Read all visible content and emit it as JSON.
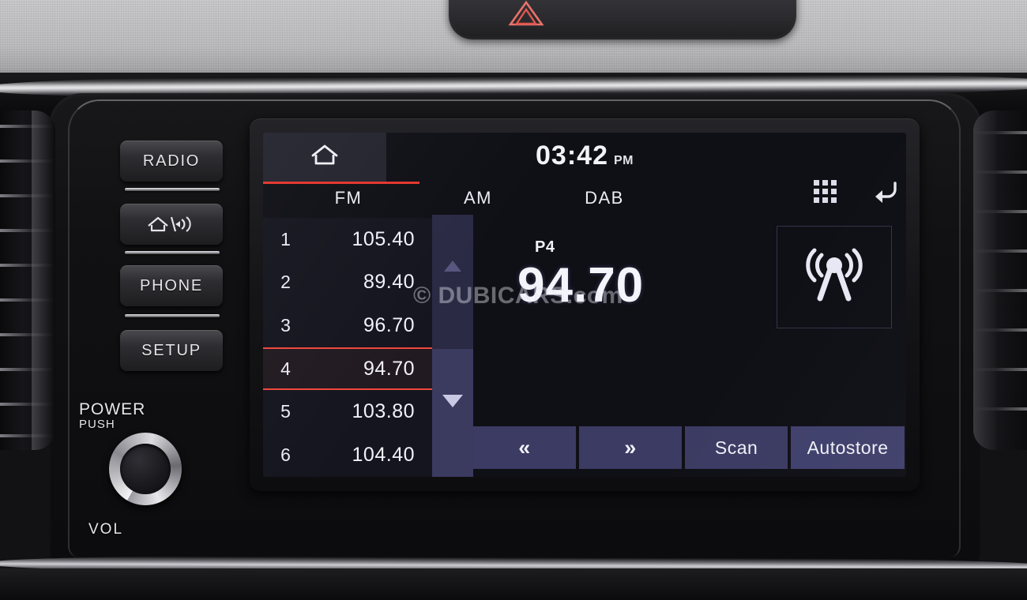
{
  "device": {
    "name": "Car Infotainment Head Unit",
    "hazard_icon": "hazard-triangle-icon"
  },
  "hard_buttons": [
    {
      "label": "RADIO",
      "name": "radio-button"
    },
    {
      "label": "",
      "name": "home-media-button",
      "icon": "home-media-icon"
    },
    {
      "label": "PHONE",
      "name": "phone-button"
    },
    {
      "label": "SETUP",
      "name": "setup-button"
    }
  ],
  "volume_knob": {
    "label_top_line1": "POWER",
    "label_top_line2": "PUSH",
    "label_bottom": "VOL"
  },
  "screen": {
    "home_icon": "home-icon",
    "clock": {
      "time": "03:42",
      "meridiem": "PM"
    },
    "tabs": [
      {
        "label": "FM",
        "active": true
      },
      {
        "label": "AM",
        "active": false
      },
      {
        "label": "DAB",
        "active": false
      }
    ],
    "top_right_icons": [
      {
        "name": "grid-menu-icon"
      },
      {
        "name": "back-arrow-icon"
      }
    ],
    "presets": [
      {
        "number": "1",
        "frequency": "105.40",
        "selected": false
      },
      {
        "number": "2",
        "frequency": "89.40",
        "selected": false
      },
      {
        "number": "3",
        "frequency": "96.70",
        "selected": false
      },
      {
        "number": "4",
        "frequency": "94.70",
        "selected": true
      },
      {
        "number": "5",
        "frequency": "103.80",
        "selected": false
      },
      {
        "number": "6",
        "frequency": "104.40",
        "selected": false
      }
    ],
    "now_playing": {
      "preset_tag": "P4",
      "frequency": "94.70",
      "band": "FM"
    },
    "station_icon": "radio-broadcast-antenna-icon",
    "actions": [
      {
        "label": "«",
        "name": "seek-down-button"
      },
      {
        "label": "»",
        "name": "seek-up-button"
      },
      {
        "label": "Scan",
        "name": "scan-button"
      },
      {
        "label": "Autostore",
        "name": "autostore-button"
      }
    ],
    "scroll": {
      "up_arrow": "scroll-up-arrow-icon",
      "down_arrow": "scroll-down-arrow-icon"
    }
  },
  "watermark": "© DUBICARS.com",
  "colors": {
    "accent_red": "#e2352c",
    "selected_red": "#f0463c",
    "lcd_bg": "#0f0f16",
    "button_blue": "#3b3b63",
    "text_light": "#f2f2f8"
  }
}
